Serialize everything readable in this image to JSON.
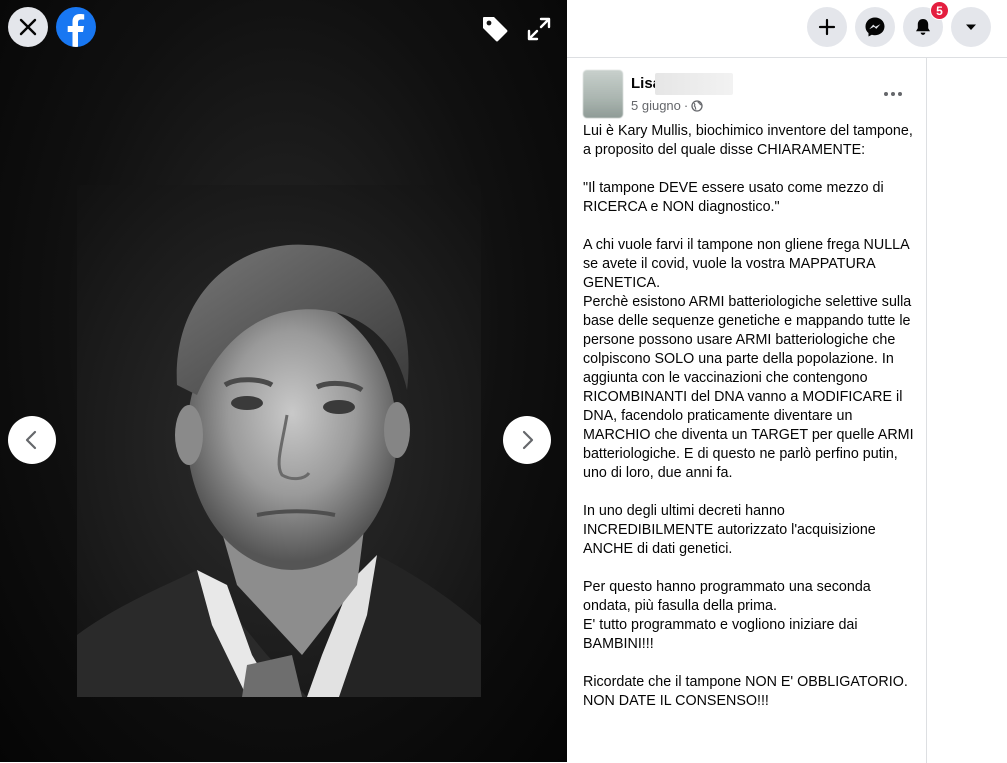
{
  "viewer": {
    "close_icon": "close-icon",
    "logo_icon": "facebook-logo-icon",
    "tag_icon": "tag-icon",
    "expand_icon": "expand-icon",
    "prev_icon": "chevron-left-icon",
    "next_icon": "chevron-right-icon"
  },
  "topbar": {
    "icons": [
      "plus-icon",
      "messenger-icon",
      "bell-icon",
      "caret-down-icon"
    ],
    "notifications_count": "5",
    "badge_color": "#e41e3f"
  },
  "post": {
    "author": "Lisa",
    "date": "5 giugno",
    "separator": "·",
    "audience_icon": "globe-icon",
    "lines": [
      "Lui è Kary Mullis, biochimico inventore del tampone, a proposito del quale disse CHIARAMENTE:",
      "",
      "\"Il tampone DEVE essere usato come mezzo di RICERCA e NON diagnostico.\"",
      "",
      "A chi vuole farvi il tampone non gliene frega NULLA se avete il covid, vuole la vostra MAPPATURA GENETICA.",
      "Perchè esistono ARMI batteriologiche selettive sulla base delle sequenze genetiche e mappando tutte le persone possono usare ARMI batteriologiche che colpiscono SOLO una parte della popolazione. In aggiunta con le vaccinazioni che contengono RICOMBINANTI del DNA vanno a MODIFICARE il DNA, facendolo praticamente diventare un MARCHIO che diventa un TARGET per quelle ARMI batteriologiche. E di questo ne parlò perfino putin, uno di loro, due anni fa.",
      "",
      "In uno degli ultimi decreti hanno INCREDIBILMENTE autorizzato l'acquisizione ANCHE di dati genetici.",
      "",
      "Per questo hanno programmato una seconda ondata, più fasulla della prima.",
      "E' tutto programmato e vogliono iniziare dai BAMBINI!!!",
      "",
      "Ricordate che il tampone NON E' OBBLIGATORIO.",
      "NON DATE IL CONSENSO!!!"
    ]
  },
  "colors": {
    "facebook_blue": "#1877f2",
    "text": "#050505",
    "secondary_text": "#65676b",
    "button_bg": "#e4e6eb"
  }
}
